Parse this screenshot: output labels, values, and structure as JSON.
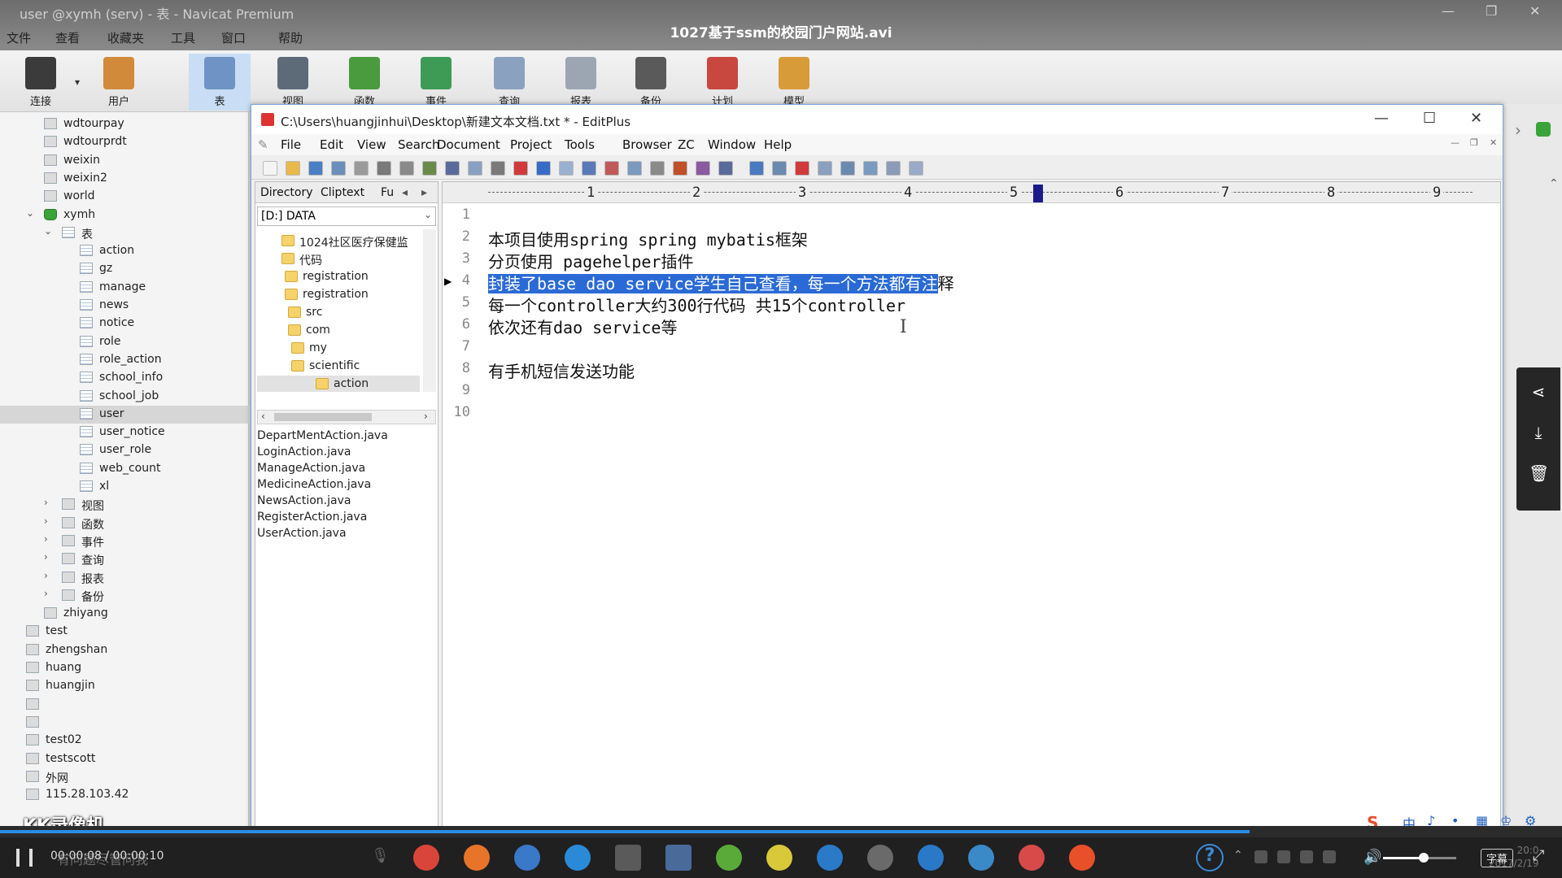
{
  "video": {
    "title": "1027基于ssm的校园门户网站.avi",
    "underlying_window_title": "user @xymh (serv) - 表 - Navicat Premium",
    "time": "00:00:08 / 00:00:10",
    "progress": 0.8,
    "volume": 0.55,
    "subtitle_button": "字幕",
    "clock_time": "20:0",
    "clock_date": "2017/2/19"
  },
  "navicat": {
    "menu": [
      "文件",
      "查看",
      "收藏夹",
      "工具",
      "窗口",
      "帮助"
    ],
    "toolbar": [
      {
        "label": "连接",
        "icon": "connection-plug-icon",
        "color": "#3b3b3b"
      },
      {
        "label": "用户",
        "icon": "user-person-icon",
        "color": "#d08a3a"
      },
      {
        "label": "表",
        "icon": "table-grid-icon",
        "color": "#6f93c4",
        "active": true
      },
      {
        "label": "视图",
        "icon": "view-glasses-icon",
        "color": "#5d6a78"
      },
      {
        "label": "函数",
        "icon": "function-fx-icon",
        "color": "#4a9a3e"
      },
      {
        "label": "事件",
        "icon": "event-clock-icon",
        "color": "#3e9b55"
      },
      {
        "label": "查询",
        "icon": "query-table-icon",
        "color": "#8aa2bf"
      },
      {
        "label": "报表",
        "icon": "report-chart-icon",
        "color": "#9ca6b3"
      },
      {
        "label": "备份",
        "icon": "backup-tape-icon",
        "color": "#5a5a5a"
      },
      {
        "label": "计划",
        "icon": "schedule-calendar-icon",
        "color": "#c8473f"
      },
      {
        "label": "模型",
        "icon": "model-diagram-icon",
        "color": "#d89b3a"
      }
    ],
    "tree": [
      {
        "label": "wdtourpay",
        "indent": 1,
        "icon": "database-icon",
        "type": "cn"
      },
      {
        "label": "wdtourprdt",
        "indent": 1,
        "icon": "database-icon",
        "type": "cn"
      },
      {
        "label": "weixin",
        "indent": 1,
        "icon": "database-icon",
        "type": "cn"
      },
      {
        "label": "weixin2",
        "indent": 1,
        "icon": "database-icon",
        "type": "cn"
      },
      {
        "label": "world",
        "indent": 1,
        "icon": "database-icon",
        "type": "cn"
      },
      {
        "label": "xymh",
        "indent": 1,
        "icon": "database-open-icon",
        "type": "db",
        "expander": "⌄"
      },
      {
        "label": "表",
        "indent": 2,
        "icon": "tables-folder-icon",
        "type": "tbl",
        "expander": "⌄"
      },
      {
        "label": "action",
        "indent": 3,
        "icon": "table-icon",
        "type": "tbl"
      },
      {
        "label": "gz",
        "indent": 3,
        "icon": "table-icon",
        "type": "tbl"
      },
      {
        "label": "manage",
        "indent": 3,
        "icon": "table-icon",
        "type": "tbl"
      },
      {
        "label": "news",
        "indent": 3,
        "icon": "table-icon",
        "type": "tbl"
      },
      {
        "label": "notice",
        "indent": 3,
        "icon": "table-icon",
        "type": "tbl"
      },
      {
        "label": "role",
        "indent": 3,
        "icon": "table-icon",
        "type": "tbl"
      },
      {
        "label": "role_action",
        "indent": 3,
        "icon": "table-icon",
        "type": "tbl"
      },
      {
        "label": "school_info",
        "indent": 3,
        "icon": "table-icon",
        "type": "tbl"
      },
      {
        "label": "school_job",
        "indent": 3,
        "icon": "table-icon",
        "type": "tbl"
      },
      {
        "label": "user",
        "indent": 3,
        "icon": "table-icon",
        "type": "tbl",
        "selected": true
      },
      {
        "label": "user_notice",
        "indent": 3,
        "icon": "table-icon",
        "type": "tbl"
      },
      {
        "label": "user_role",
        "indent": 3,
        "icon": "table-icon",
        "type": "tbl"
      },
      {
        "label": "web_count",
        "indent": 3,
        "icon": "table-icon",
        "type": "tbl"
      },
      {
        "label": "xl",
        "indent": 3,
        "icon": "table-icon",
        "type": "tbl"
      },
      {
        "label": "视图",
        "indent": 2,
        "icon": "views-icon",
        "type": "cn",
        "expander": "›"
      },
      {
        "label": "函数",
        "indent": 2,
        "icon": "functions-icon",
        "type": "cn",
        "expander": "›"
      },
      {
        "label": "事件",
        "indent": 2,
        "icon": "events-icon",
        "type": "cn",
        "expander": "›"
      },
      {
        "label": "查询",
        "indent": 2,
        "icon": "queries-icon",
        "type": "cn",
        "expander": "›"
      },
      {
        "label": "报表",
        "indent": 2,
        "icon": "reports-icon",
        "type": "cn",
        "expander": "›"
      },
      {
        "label": "备份",
        "indent": 2,
        "icon": "backups-icon",
        "type": "cn",
        "expander": "›"
      },
      {
        "label": "zhiyang",
        "indent": 1,
        "icon": "database-icon",
        "type": "cn"
      },
      {
        "label": "test",
        "indent": 0,
        "icon": "connection-icon",
        "type": "cn"
      },
      {
        "label": "zhengshan",
        "indent": 0,
        "icon": "connection-icon",
        "type": "cn"
      },
      {
        "label": "huang",
        "indent": 0,
        "icon": "connection-icon",
        "type": "cn"
      },
      {
        "label": "huangjin",
        "indent": 0,
        "icon": "connection-icon",
        "type": "cn"
      },
      {
        "label": "",
        "indent": 0,
        "icon": "connection-icon",
        "type": "cn"
      },
      {
        "label": "",
        "indent": 0,
        "icon": "connection-icon",
        "type": "cn"
      },
      {
        "label": "test02",
        "indent": 0,
        "icon": "connection-icon",
        "type": "cn"
      },
      {
        "label": "testscott",
        "indent": 0,
        "icon": "connection-icon",
        "type": "cn"
      },
      {
        "label": "外网",
        "indent": 0,
        "icon": "connection-icon",
        "type": "cn"
      },
      {
        "label": "115.28.103.42",
        "indent": 0,
        "icon": "connection-icon",
        "type": "cn"
      }
    ],
    "watermark": "KK录像机"
  },
  "editplus": {
    "title": "C:\\Users\\huangjinhui\\Desktop\\新建文本文档.txt * - EditPlus",
    "menu": [
      "File",
      "Edit",
      "View",
      "Search",
      "Document",
      "Project",
      "Tools",
      "Browser",
      "ZC",
      "Window",
      "Help"
    ],
    "toolbar_icons": [
      {
        "name": "new-file-icon",
        "color": "#f4f4f4"
      },
      {
        "name": "open-folder-icon",
        "color": "#e8b94a"
      },
      {
        "name": "save-icon",
        "color": "#4a7fc4"
      },
      {
        "name": "save-all-icon",
        "color": "#6a8fba"
      },
      {
        "name": "ftp-icon",
        "color": "#9a9a9a"
      },
      {
        "name": "print-icon",
        "color": "#7a7a7a"
      },
      {
        "name": "print-preview-icon",
        "color": "#8a8a8a"
      },
      {
        "name": "spell-check-icon",
        "color": "#6a8a4a"
      },
      {
        "name": "cut-icon",
        "color": "#5a6a9a"
      },
      {
        "name": "copy-icon",
        "color": "#8aa0c0"
      },
      {
        "name": "paste-icon",
        "color": "#7a7a7a"
      },
      {
        "name": "delete-icon",
        "color": "#d03a3a"
      },
      {
        "name": "undo-icon",
        "color": "#3a6ac8"
      },
      {
        "name": "redo-icon",
        "color": "#9ab0d0"
      },
      {
        "name": "find-icon",
        "color": "#5a7ab8"
      },
      {
        "name": "replace-icon",
        "color": "#c05a5a"
      },
      {
        "name": "find-in-files-icon",
        "color": "#7a9ac0"
      },
      {
        "name": "goto-line-icon",
        "color": "#8a8a8a"
      },
      {
        "name": "font-icon",
        "color": "#c0502a"
      },
      {
        "name": "hex-icon",
        "color": "#8a5aa0"
      },
      {
        "name": "word-wrap-icon",
        "color": "#5a6a9a"
      },
      {
        "name": "ruler-icon",
        "color": "#4a7ac0"
      },
      {
        "name": "line-number-icon",
        "color": "#6a8ab0"
      },
      {
        "name": "check-icon",
        "color": "#d03a3a"
      },
      {
        "name": "window-icon",
        "color": "#8aa0c0"
      },
      {
        "name": "output-icon",
        "color": "#6a8ab0"
      },
      {
        "name": "directory-icon",
        "color": "#7a9ac0"
      },
      {
        "name": "cliptext-icon",
        "color": "#8a9ab8"
      },
      {
        "name": "help-icon",
        "color": "#9aaac8"
      }
    ],
    "dir_tabs": [
      "Directory",
      "Cliptext",
      "Fu"
    ],
    "drive": "[D:] DATA",
    "folders": [
      {
        "label": "1024社区医疗保健监",
        "indent": 0
      },
      {
        "label": "代码",
        "indent": 0
      },
      {
        "label": "registration",
        "indent": 1
      },
      {
        "label": "registration",
        "indent": 1
      },
      {
        "label": "src",
        "indent": 2
      },
      {
        "label": "com",
        "indent": 2
      },
      {
        "label": "my",
        "indent": 3
      },
      {
        "label": "scientific",
        "indent": 3
      },
      {
        "label": "action",
        "indent": 4,
        "selected": true
      }
    ],
    "files": [
      "DepartMentAction.java",
      "LoginAction.java",
      "ManageAction.java",
      "MedicineAction.java",
      "NewsAction.java",
      "RegisterAction.java",
      "UserAction.java"
    ],
    "ruler_numbers": [
      "1",
      "2",
      "3",
      "4",
      "5",
      "6",
      "7",
      "8",
      "9"
    ],
    "lines": [
      {
        "n": "1",
        "text": ""
      },
      {
        "n": "2",
        "text": "本项目使用spring spring mybatis框架"
      },
      {
        "n": "3",
        "text": "分页使用 pagehelper插件"
      },
      {
        "n": "4",
        "text": "封装了base dao service学生自己查看，每一个方法都有注",
        "tail": "释",
        "highlighted": true
      },
      {
        "n": "5",
        "text": "每一个controller大约300行代码 共15个controller"
      },
      {
        "n": "6",
        "text": "依次还有dao service等"
      },
      {
        "n": "7",
        "text": ""
      },
      {
        "n": "8",
        "text": "有手机短信发送功能"
      },
      {
        "n": "9",
        "text": ""
      },
      {
        "n": "10",
        "text": ""
      }
    ]
  },
  "player_sidebar": [
    {
      "icon": "share-icon",
      "glyph": "⋖"
    },
    {
      "icon": "download-icon",
      "glyph": "⤓"
    },
    {
      "icon": "delete-icon",
      "glyph": "🗑"
    }
  ],
  "ime": [
    "中",
    "♪",
    "•",
    "▦",
    "♔",
    "⚙"
  ],
  "taskbar": {
    "search_placeholder": "有问题尽管问我",
    "apps": [
      {
        "name": "chrome-icon",
        "color": "#d9453a"
      },
      {
        "name": "firefox-icon",
        "color": "#e8742a"
      },
      {
        "name": "sogou-browser-icon",
        "color": "#3a78c8"
      },
      {
        "name": "edge-icon",
        "color": "#2a8ad8"
      },
      {
        "name": "store-icon",
        "color": "#5a5a5a"
      },
      {
        "name": "calculator-icon",
        "color": "#4a6a9a"
      },
      {
        "name": "leaf-icon",
        "color": "#5aaa3a"
      },
      {
        "name": "bird-icon",
        "color": "#d8c83a"
      },
      {
        "name": "picture-icon",
        "color": "#2a7ac8"
      },
      {
        "name": "settings-gear-icon",
        "color": "#6a6a6a"
      },
      {
        "name": "kk-recorder-icon",
        "color": "#2a78c8"
      },
      {
        "name": "navicat-icon",
        "color": "#3a8ac8"
      },
      {
        "name": "editplus-icon",
        "color": "#d84a4a"
      },
      {
        "name": "recorder-face-icon",
        "color": "#e8502a"
      }
    ]
  }
}
